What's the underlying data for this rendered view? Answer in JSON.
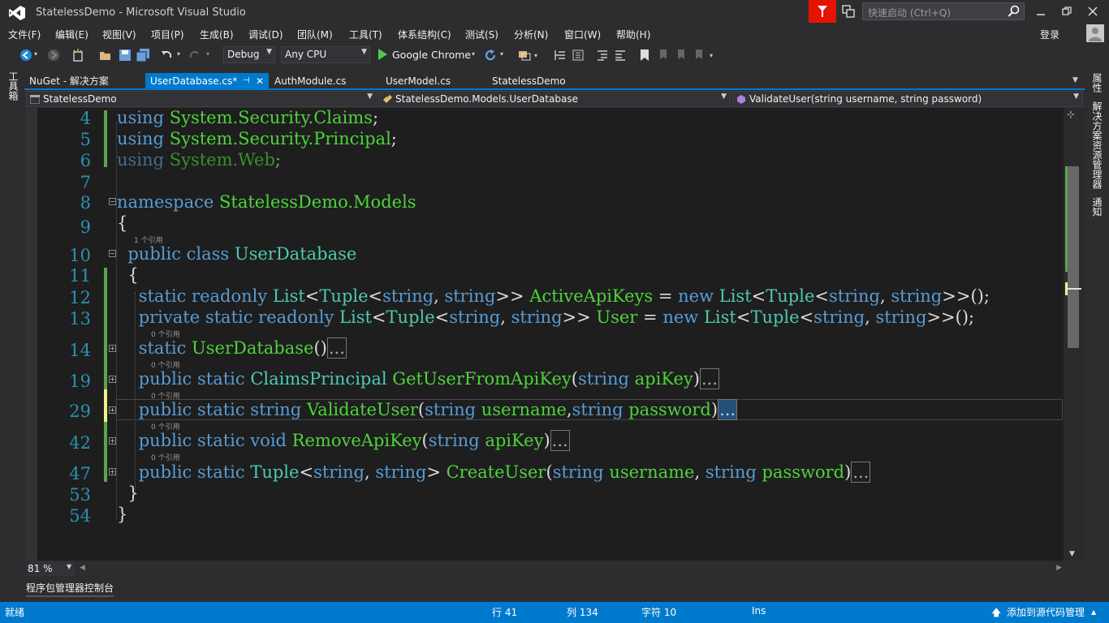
{
  "window": {
    "title": "StatelessDemo - Microsoft Visual Studio",
    "quick_launch_placeholder": "快速启动 (Ctrl+Q)",
    "login": "登录"
  },
  "menu": [
    "文件(F)",
    "编辑(E)",
    "视图(V)",
    "项目(P)",
    "生成(B)",
    "调试(D)",
    "团队(M)",
    "工具(T)",
    "体系结构(C)",
    "测试(S)",
    "分析(N)",
    "窗口(W)",
    "帮助(H)"
  ],
  "toolbar": {
    "config": "Debug",
    "platform": "Any CPU",
    "run_target": "Google Chrome"
  },
  "left_panel": {
    "toolbox": "工具箱"
  },
  "tabs": [
    {
      "label": "NuGet - 解决方案"
    },
    {
      "label": "UserDatabase.cs*",
      "active": true
    },
    {
      "label": "AuthModule.cs"
    },
    {
      "label": "UserModel.cs"
    },
    {
      "label": "StatelessDemo"
    }
  ],
  "navbar": {
    "project": "StatelessDemo",
    "type": "StatelessDemo.Models.UserDatabase",
    "member": "ValidateUser(string username, string password)"
  },
  "code": {
    "line_numbers": [
      "4",
      "5",
      "6",
      "7",
      "8",
      "9",
      "10",
      "11",
      "12",
      "13",
      "14",
      "19",
      "29",
      "42",
      "47",
      "53",
      "54"
    ],
    "lens_1": "1 个引用",
    "lens_0": "0 个引用",
    "collapsed": "..."
  },
  "editor": {
    "zoom": "81 %"
  },
  "right_panel": [
    "属性",
    "解决方案资源管理器",
    "通知"
  ],
  "bottom_panel": {
    "tab": "程序包管理器控制台"
  },
  "status": {
    "ready": "就绪",
    "row": "行 41",
    "col": "列 134",
    "char": "字符 10",
    "ins": "Ins",
    "source_control": "添加到源代码管理"
  }
}
